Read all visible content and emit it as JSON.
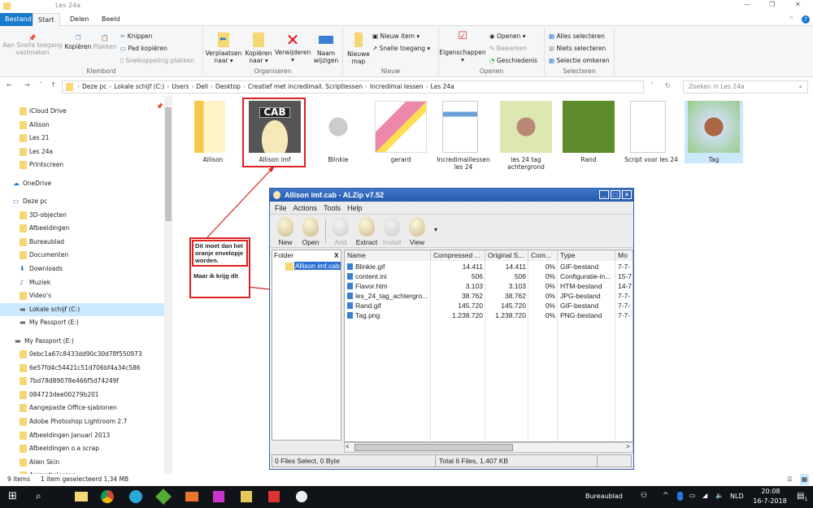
{
  "window": {
    "title": "Les 24a"
  },
  "tabs": [
    "Bestand",
    "Start",
    "Delen",
    "Beeld"
  ],
  "ribbon": {
    "klembord": {
      "label": "Klembord",
      "pin": "Aan Snelle toegang vastmaken",
      "copy": "Kopiëren",
      "paste": "Plakken",
      "cut": "Knippen",
      "copy_path": "Pad kopiëren",
      "paste_shortcut": "Snelkoppeling plakken"
    },
    "organiseren": {
      "label": "Organiseren",
      "move": "Verplaatsen naar",
      "copy_to": "Kopiëren naar",
      "delete": "Verwijderen",
      "rename": "Naam wijzigen"
    },
    "nieuw": {
      "label": "Nieuw",
      "new_folder": "Nieuwe map",
      "new_item": "Nieuw item",
      "easy_access": "Snelle toegang"
    },
    "openen": {
      "label": "Openen",
      "properties": "Eigenschappen",
      "open": "Openen",
      "edit": "Bewerken",
      "history": "Geschiedenis"
    },
    "selecteren": {
      "label": "Selecteren",
      "all": "Alles selecteren",
      "none": "Niets selecteren",
      "invert": "Selectie omkeren"
    }
  },
  "address": {
    "crumbs": [
      "Deze pc",
      "Lokale schijf (C:)",
      "Users",
      "Dell",
      "Desktop",
      "Creatief met incredimail. Scriptlessen",
      "Incredimai lessen",
      "Les 24a"
    ],
    "search_placeholder": "Zoeken in Les 24a"
  },
  "sidebar": [
    {
      "label": "iCloud Drive",
      "type": "folder"
    },
    {
      "label": "Allison",
      "type": "folder"
    },
    {
      "label": "Les 21",
      "type": "folder"
    },
    {
      "label": "Les 24a",
      "type": "folder"
    },
    {
      "label": "Printscreen",
      "type": "folder"
    },
    {
      "label": "OneDrive",
      "type": "cloud"
    },
    {
      "label": "Deze pc",
      "type": "pc"
    },
    {
      "label": "3D-objecten",
      "type": "folder"
    },
    {
      "label": "Afbeeldingen",
      "type": "folder"
    },
    {
      "label": "Bureaublad",
      "type": "folder"
    },
    {
      "label": "Documenten",
      "type": "folder"
    },
    {
      "label": "Downloads",
      "type": "download"
    },
    {
      "label": "Muziek",
      "type": "music"
    },
    {
      "label": "Video's",
      "type": "folder"
    },
    {
      "label": "Lokale schijf (C:)",
      "type": "drive",
      "selected": true
    },
    {
      "label": "My Passport (E:)",
      "type": "drive"
    },
    {
      "label": "My Passport (E:)",
      "type": "drive"
    },
    {
      "label": "0ebc1a67c8433dd90c30d78f550973",
      "type": "folder"
    },
    {
      "label": "6e57fd4c54421c51d706bf4a34c586",
      "type": "folder"
    },
    {
      "label": "7bd78d89078e466f5d74249f",
      "type": "folder"
    },
    {
      "label": "084723dee00279b201",
      "type": "folder"
    },
    {
      "label": "Aangepaste Office-sjablonen",
      "type": "folder"
    },
    {
      "label": "Adobe Photoshop Lightroom 2.7",
      "type": "folder"
    },
    {
      "label": "Afbeeldingen Januari 2013",
      "type": "folder"
    },
    {
      "label": "Afbeeldingen o.a scrap",
      "type": "folder"
    },
    {
      "label": "Alien Skin",
      "type": "folder"
    },
    {
      "label": "Animatielessen",
      "type": "folder"
    }
  ],
  "files": [
    {
      "name": "Allison",
      "thumb": "folder"
    },
    {
      "name": "Allison imf",
      "thumb": "cab",
      "highlighted": true
    },
    {
      "name": "Blinkie",
      "thumb": "dove"
    },
    {
      "name": "gerard",
      "thumb": "gerard"
    },
    {
      "name": "Incredimaillessen les 24",
      "thumb": "doc"
    },
    {
      "name": "les 24 tag achtergrond",
      "thumb": "bg"
    },
    {
      "name": "Rand",
      "thumb": "green"
    },
    {
      "name": "Script voor les 24",
      "thumb": "txt"
    },
    {
      "name": "Tag",
      "thumb": "tag",
      "selected": true
    }
  ],
  "status": {
    "count": "9 items",
    "selection": "1 item geselecteerd  1,34 MB"
  },
  "annotation": {
    "line1": "Dit moet dan het oranje envelopje worden.",
    "line2": "Maar ik krijg dit",
    "color": "#dd2222"
  },
  "alzip": {
    "title": "Allison imf.cab - ALZip v7.52",
    "menu": [
      "File",
      "Actions",
      "Tools",
      "Help"
    ],
    "toolbar": [
      {
        "label": "New",
        "enabled": true
      },
      {
        "label": "Open",
        "enabled": true
      },
      {
        "label": "Add",
        "enabled": false
      },
      {
        "label": "Extract",
        "enabled": true
      },
      {
        "label": "Install",
        "enabled": false
      },
      {
        "label": "View",
        "enabled": true
      }
    ],
    "folder_header": "Folder",
    "folder_close": "X",
    "folder_item": "Allison imf.cab",
    "columns": [
      "Name",
      "Compressed ...",
      "Original S...",
      "Com...",
      "Type",
      "Mo"
    ],
    "rows": [
      [
        "Blinkie.gif",
        "14.411",
        "14.411",
        "0%",
        "GIF-bestand",
        "7-7-"
      ],
      [
        "content.ini",
        "506",
        "506",
        "0%",
        "Configuratie-in...",
        "15-7"
      ],
      [
        "Flavor.htm",
        "3.103",
        "3.103",
        "0%",
        "HTM-bestand",
        "14-7"
      ],
      [
        "les_24_tag_achtergro...",
        "38.762",
        "38.762",
        "0%",
        "JPG-bestand",
        "7-7-"
      ],
      [
        "Rand.gif",
        "145.720",
        "145.720",
        "0%",
        "GIF-bestand",
        "7-7-"
      ],
      [
        "Tag.png",
        "1.238.720",
        "1.238.720",
        "0%",
        "PNG-bestand",
        "7-7-"
      ]
    ],
    "status_left": "0 Files Select,  0 Byte",
    "status_right": "Total 6 Files,  1.407 KB"
  },
  "taskbar": {
    "desktop_label": "Bureaublad",
    "lang": "NLD",
    "time": "20:08",
    "date": "16-7-2018",
    "notifications": "1"
  }
}
